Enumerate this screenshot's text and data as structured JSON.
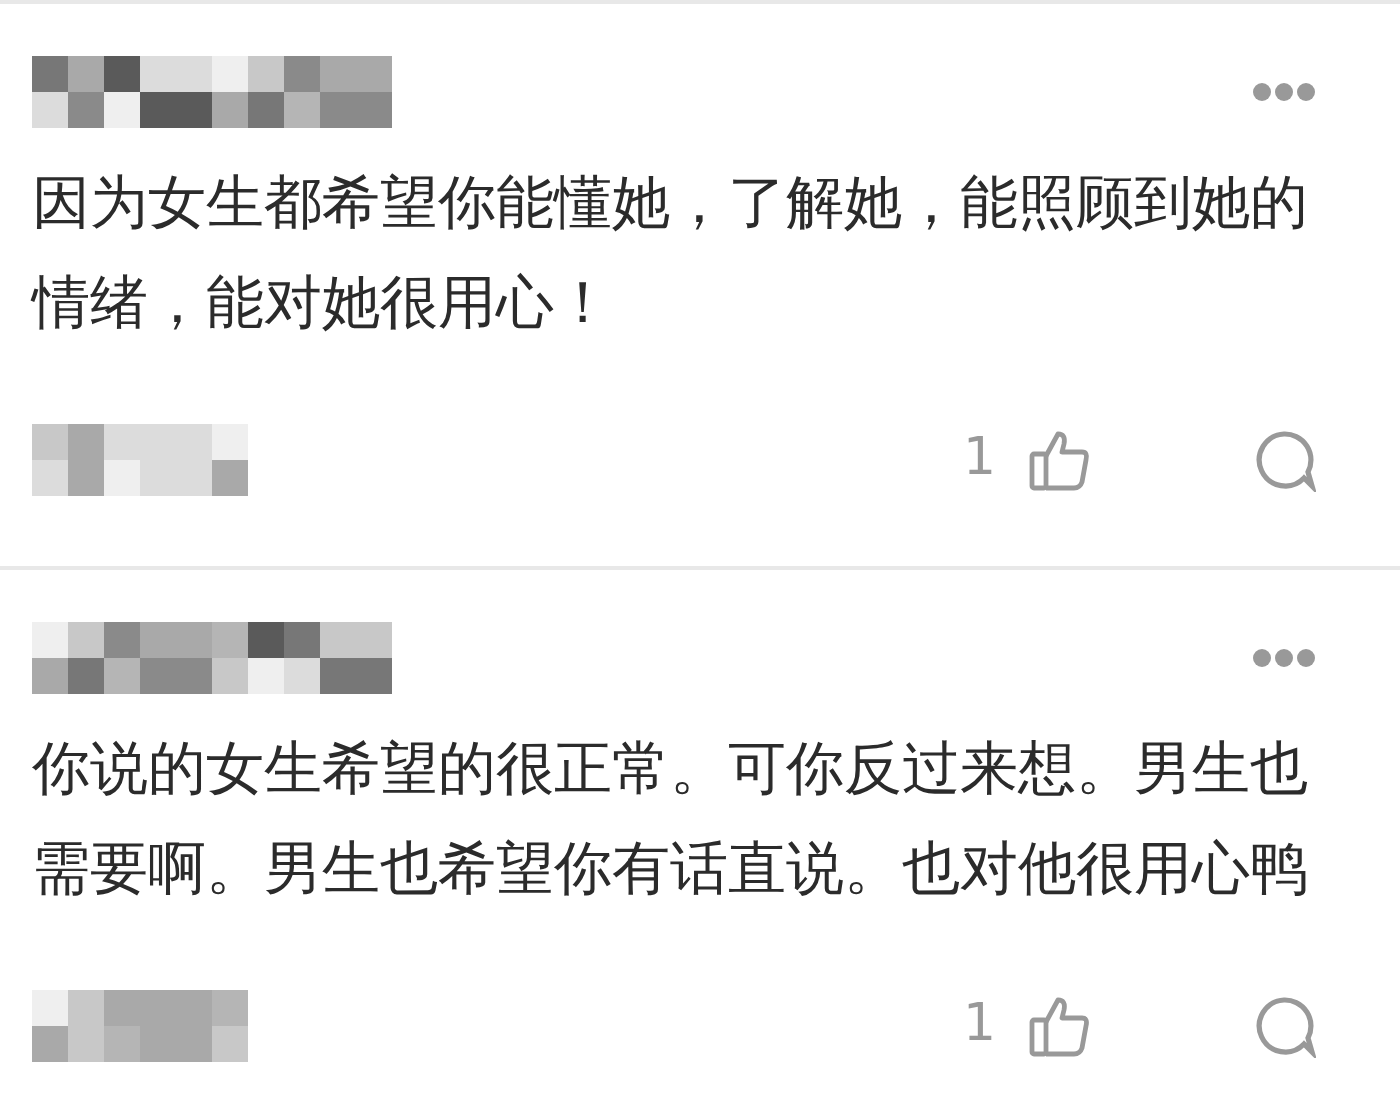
{
  "comments": [
    {
      "text": "因为女生都希望你能懂她，了解她，能照顾到她的情绪，能对她很用心！",
      "likes": "1"
    },
    {
      "text": "你说的女生希望的很正常。可你反过来想。男生也需要啊。男生也希望你有话直说。也对他很用心鸭",
      "likes": "1"
    }
  ]
}
